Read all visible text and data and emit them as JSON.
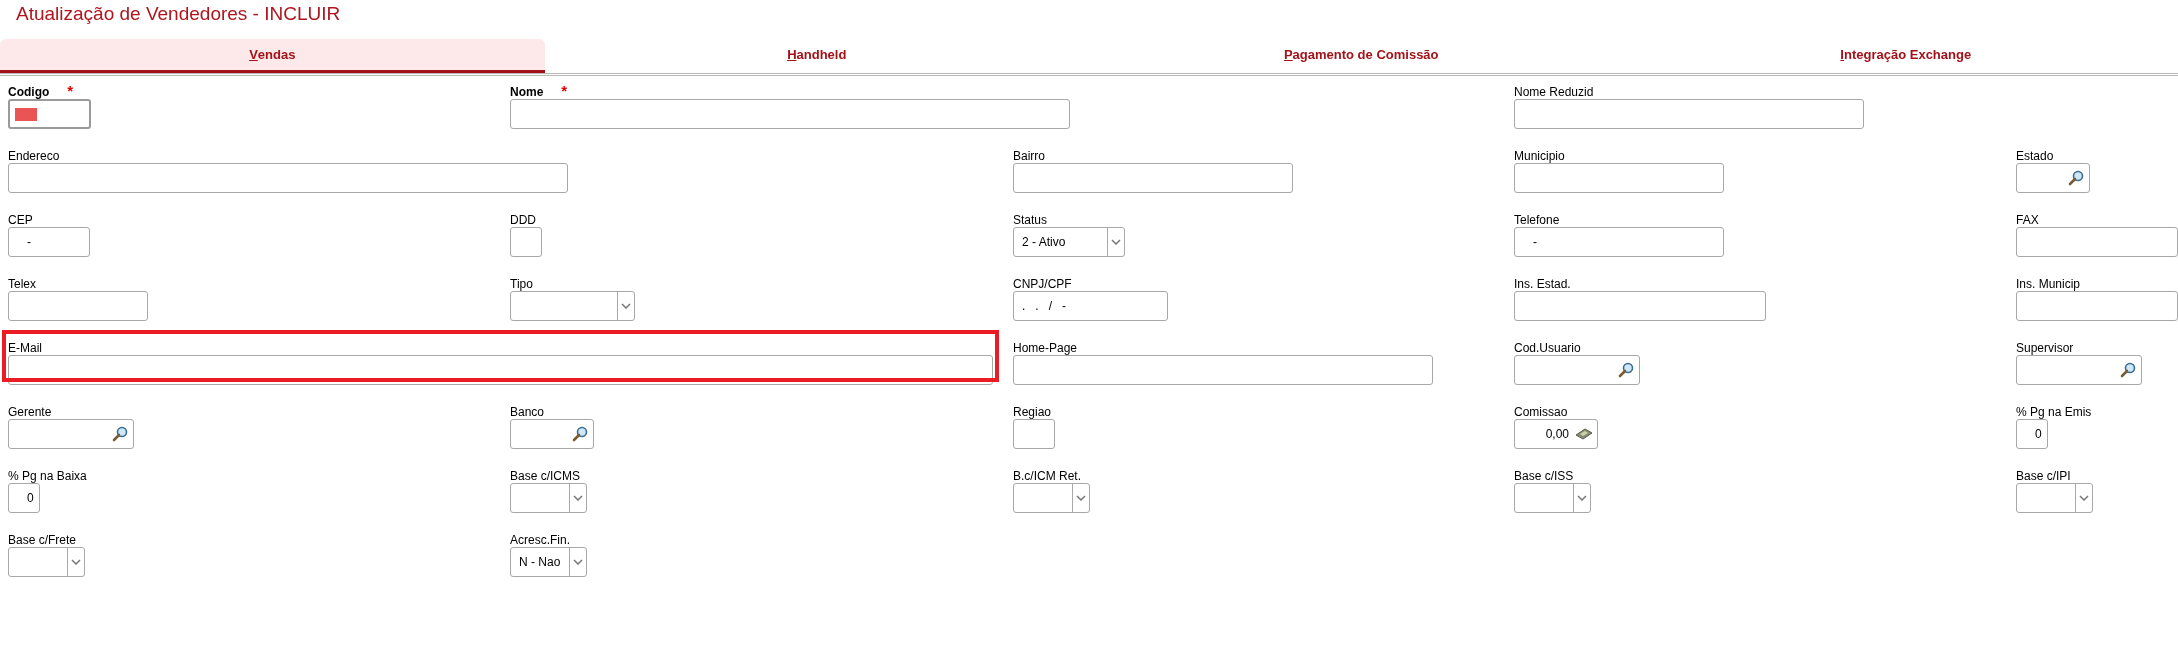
{
  "title": "Atualização de Vendedores - INCLUIR",
  "tabs": [
    {
      "label": "Vendas",
      "selected": true
    },
    {
      "label": "Handheld",
      "selected": false
    },
    {
      "label": "Pagamento de Comissão",
      "selected": false
    },
    {
      "label": "Integração Exchange",
      "selected": false
    }
  ],
  "rows": [
    [
      {
        "label": "Codigo",
        "marker": "*",
        "kind": "text",
        "focused": true,
        "filled_block": true
      },
      {
        "label": "Nome",
        "marker": "*",
        "kind": "text"
      },
      {
        "label": "Nome Reduzid",
        "kind": "text"
      }
    ],
    [
      {
        "label": "Endereco",
        "kind": "text"
      },
      {
        "label": "Bairro",
        "kind": "text"
      },
      {
        "label": "Municipio",
        "kind": "text"
      },
      {
        "label": "Estado",
        "kind": "lookup"
      }
    ],
    [
      {
        "label": "CEP",
        "kind": "text",
        "value": "-"
      },
      {
        "label": "DDD",
        "kind": "text"
      },
      {
        "label": "Status",
        "kind": "select",
        "value": "2 - Ativo"
      },
      {
        "label": "Telefone",
        "kind": "text",
        "value": "-"
      },
      {
        "label": "FAX",
        "kind": "text"
      }
    ],
    [
      {
        "label": "Telex",
        "kind": "text"
      },
      {
        "label": "Tipo",
        "kind": "select"
      },
      {
        "label": "CNPJ/CPF",
        "kind": "text",
        "value": ".   .   /   -"
      },
      {
        "label": "Ins. Estad.",
        "kind": "text"
      },
      {
        "label": "Ins. Municip",
        "kind": "text"
      }
    ],
    [
      {
        "label": "E-Mail",
        "kind": "text",
        "highlighted": true
      },
      {
        "label": "Home-Page",
        "kind": "text"
      },
      {
        "label": "Cod.Usuario",
        "kind": "lookup"
      },
      {
        "label": "Supervisor",
        "kind": "lookup"
      }
    ],
    [
      {
        "label": "Gerente",
        "kind": "lookup"
      },
      {
        "label": "Banco",
        "kind": "lookup"
      },
      {
        "label": "Regiao",
        "kind": "text"
      },
      {
        "label": "Comissao",
        "kind": "amount",
        "value": "0,00"
      },
      {
        "label": "% Pg na Emis",
        "kind": "number",
        "value": "0"
      }
    ],
    [
      {
        "label": "% Pg na Baixa",
        "kind": "number",
        "value": "0"
      },
      {
        "label": "Base c/ICMS",
        "kind": "select"
      },
      {
        "label": "B.c/ICM Ret.",
        "kind": "select"
      },
      {
        "label": "Base c/ISS",
        "kind": "select"
      },
      {
        "label": "Base c/IPI",
        "kind": "select"
      }
    ],
    [
      {
        "label": "Base c/Frete",
        "kind": "select"
      },
      {
        "label": "Acresc.Fin.",
        "kind": "select",
        "value": "N - Nao"
      }
    ]
  ]
}
